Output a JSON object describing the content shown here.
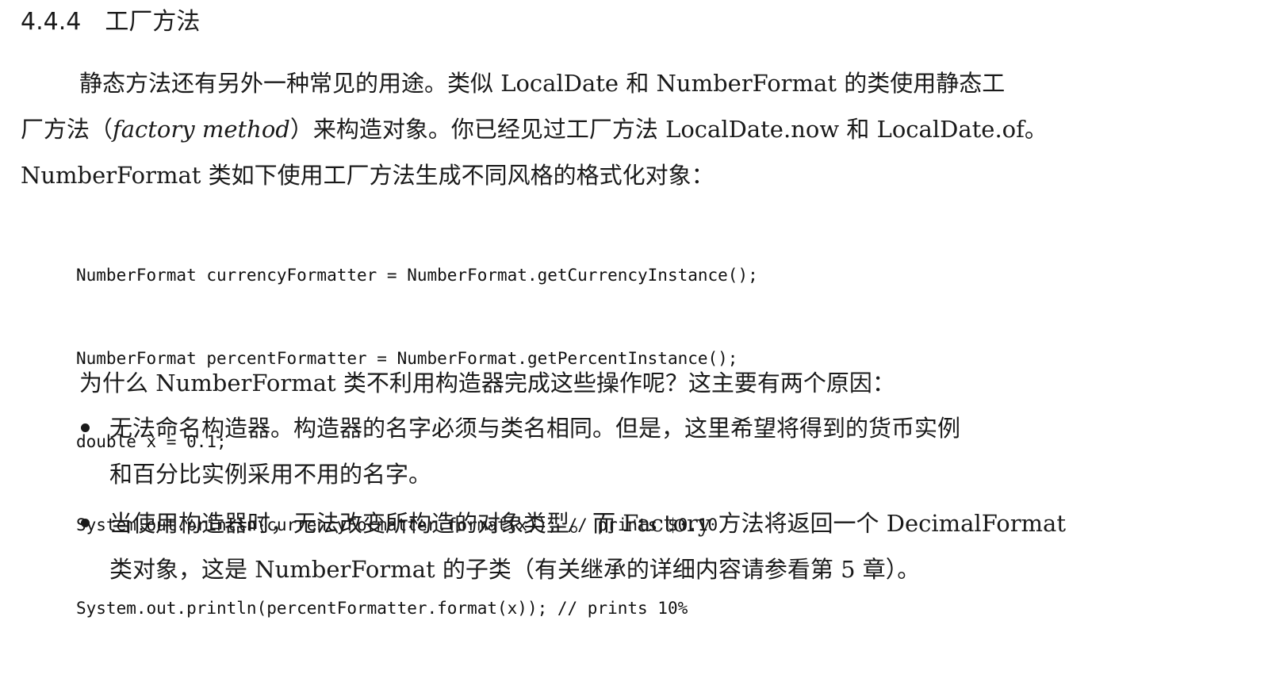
{
  "section": {
    "number": "4.4.4",
    "title": "工厂方法"
  },
  "intro": {
    "line1": "静态方法还有另外一种常见的用途。类似 LocalDate 和 NumberFormat 的类使用静态工",
    "line2_before": "厂方法（",
    "line2_em": "factory method",
    "line2_after": "）来构造对象。你已经见过工厂方法 LocalDate.now 和 LocalDate.of。",
    "line3": "NumberFormat 类如下使用工厂方法生成不同风格的格式化对象："
  },
  "code": [
    "NumberFormat currencyFormatter = NumberFormat.getCurrencyInstance();",
    "NumberFormat percentFormatter = NumberFormat.getPercentInstance();",
    "double x = 0.1;",
    "System.out.println(currencyFormatter.format(x)); // prints $0.10",
    "System.out.println(percentFormatter.format(x)); // prints 10%"
  ],
  "question": "为什么 NumberFormat 类不利用构造器完成这些操作呢？这主要有两个原因：",
  "bullets": [
    {
      "line1": "无法命名构造器。构造器的名字必须与类名相同。但是，这里希望将得到的货币实例",
      "line2": "和百分比实例采用不用的名字。"
    },
    {
      "line1": "当使用构造器时，无法改变所构造的对象类型。而 Factory 方法将返回一个 DecimalFormat",
      "line2": "类对象，这是 NumberFormat 的子类（有关继承的详细内容请参看第 5 章）。"
    }
  ]
}
